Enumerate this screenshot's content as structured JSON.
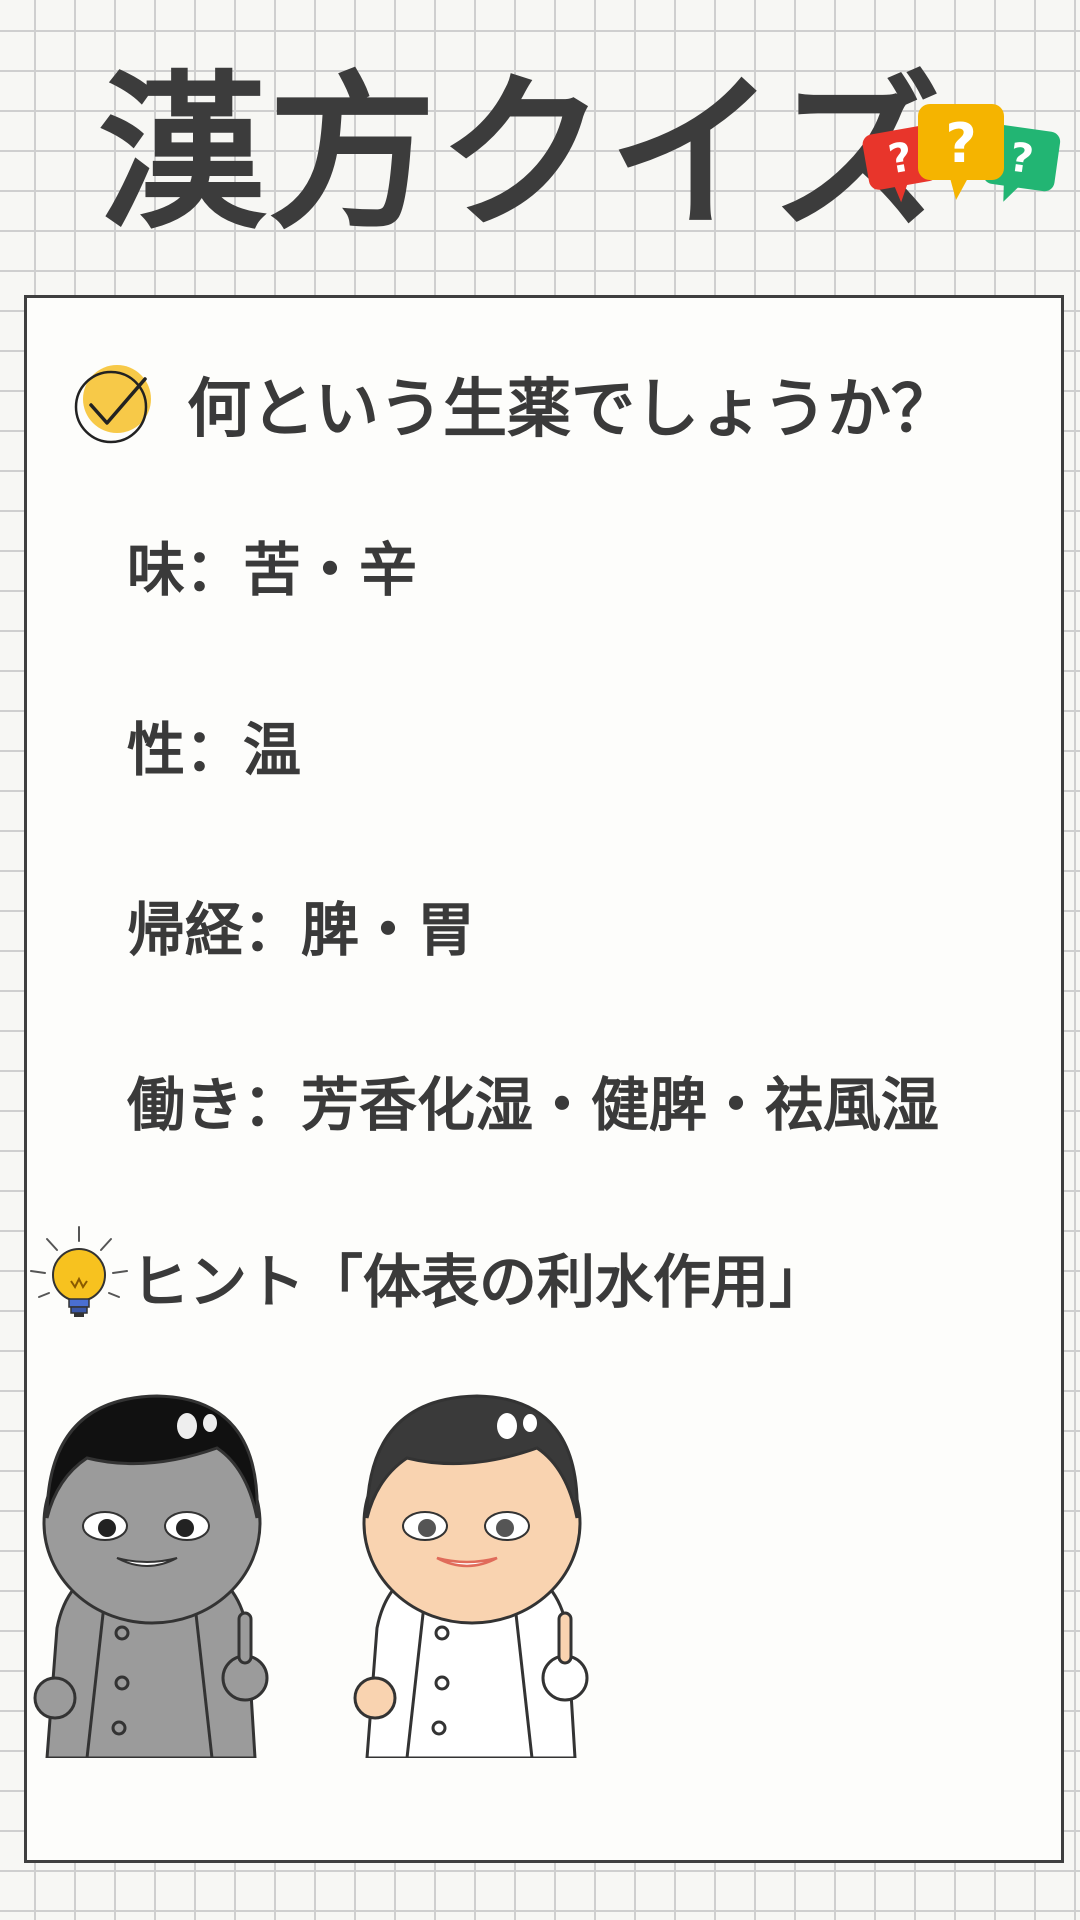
{
  "title": "漢方クイズ",
  "question": "何という生薬でしょうか？",
  "attributes": {
    "taste": "味：苦・辛",
    "nature": "性：温",
    "meridians": "帰経：脾・胃",
    "actions": "働き：芳香化湿・健脾・祛風湿"
  },
  "hint": "ヒント「体表の利水作用」",
  "icons": {
    "title_decoration": "question-bubbles-icon",
    "question_marker": "checkmark-circle-icon",
    "hint_marker": "lightbulb-icon"
  },
  "colors": {
    "bubble_red": "#e8352b",
    "bubble_orange": "#f5b400",
    "bubble_green": "#22b573",
    "check_yellow": "#f7c948",
    "text": "#3a3a3a"
  }
}
